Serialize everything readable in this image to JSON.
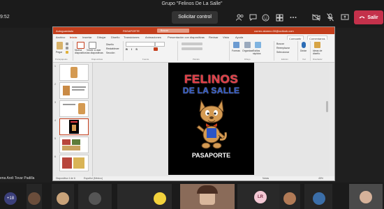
{
  "meeting": {
    "title": "Grupo \"Felinos De La Salle\"",
    "elapsed": "9:52",
    "control_label": "Solicitar control",
    "leave_label": "Salir",
    "presenter_name": "ena Areli Tovar Padilla"
  },
  "ppt": {
    "autosave": "Autoguardado",
    "filename": "PASAPORTE",
    "search_placeholder": "Buscar",
    "account": "correo.alumno.00@outlook.com",
    "tabs": [
      "Archivo",
      "Inicio",
      "Insertar",
      "Dibujar",
      "Diseño",
      "Transiciones",
      "Animaciones",
      "Presentación con diapositivas",
      "Revisar",
      "Vista",
      "Ayuda"
    ],
    "share_label": "Compartir",
    "comments_label": "Comentarios",
    "ribbon": {
      "paste": "Pegar",
      "new_slide": "Nueva diapositiva",
      "reuse": "Volver a usar las diapositivas",
      "layout": "Diseño",
      "reset": "Restablecer",
      "section": "Sección",
      "shapes": "Formas",
      "arrange": "Organizar",
      "quick_styles": "Estilos rápidos",
      "find": "Buscar",
      "replace": "Reemplazar",
      "select": "Seleccionar",
      "dictate": "Dictar",
      "designer": "Ideas de diseño"
    },
    "groups": [
      "Portapapeles",
      "Diapositivas",
      "Fuente",
      "Párrafo",
      "Dibujo",
      "Edición",
      "Voz",
      "Diseñador"
    ],
    "slide_numbers": [
      "1",
      "2",
      "3",
      "4",
      "5",
      "6"
    ],
    "status_left": "Diapositiva 4 de 6",
    "status_lang": "Español (México)",
    "status_notes": "Notas",
    "status_zoom": "45%"
  },
  "slide": {
    "title_line1": "FELINOS",
    "title_line2": "DE LA SALLE",
    "caption": "PASAPORTE"
  },
  "participants": {
    "more_count": "+18",
    "initials": "LR",
    "names": [
      "",
      "",
      "",
      "",
      "",
      ""
    ]
  },
  "colors": {
    "ppt_accent": "#c43e1c",
    "leave": "#c4314b",
    "title_red": "#e23b43",
    "title_blue": "#2b55c7"
  }
}
